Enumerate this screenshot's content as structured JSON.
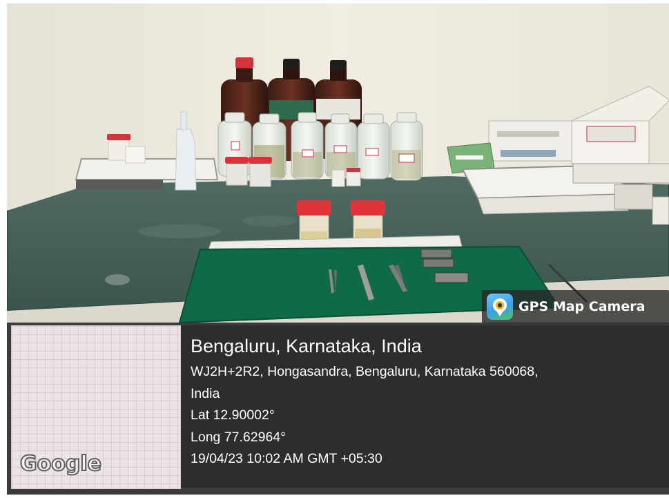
{
  "photo": {
    "subject": "laboratory bench with reagent bottles, specimen containers and dissection instruments"
  },
  "camera_badge": {
    "label": "GPS Map Camera",
    "icon": "map-pin-camera-icon"
  },
  "map": {
    "provider_logo": "Google"
  },
  "location": {
    "city_line": "Bengaluru, Karnataka, India",
    "address_line1": "WJ2H+2R2, Hongasandra, Bengaluru, Karnataka 560068,",
    "address_line2": "India",
    "latitude": "Lat 12.90002°",
    "longitude": "Long 77.62964°",
    "timestamp": "19/04/23 10:02 AM GMT +05:30"
  },
  "colors": {
    "wall": "#ece8dd",
    "table_cloth": "#3f5c54",
    "green_towel": "#0f6a48",
    "cap_red": "#e0343a",
    "overlay": "#262626"
  }
}
